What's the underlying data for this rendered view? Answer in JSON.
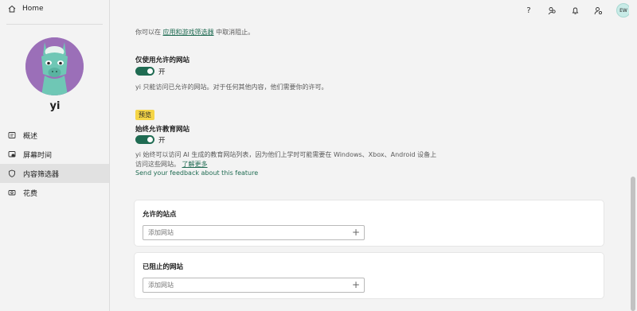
{
  "sidebar": {
    "home_label": "Home",
    "profile_name": "yi",
    "items": [
      {
        "label": "概述",
        "icon": "overview-icon"
      },
      {
        "label": "屏幕时间",
        "icon": "screen-time-icon"
      },
      {
        "label": "内容筛选器",
        "icon": "shield-icon",
        "active": true
      },
      {
        "label": "花费",
        "icon": "spending-icon"
      }
    ]
  },
  "topbar": {
    "user_initials": "EW",
    "icons": [
      "help-icon",
      "family-icon",
      "notification-icon",
      "account-settings-icon"
    ]
  },
  "main": {
    "intro_prefix": "你可以在",
    "intro_link": "应用和游戏筛选器",
    "intro_suffix": "中取消阻止。",
    "allowed_only": {
      "title": "仅使用允许的网站",
      "toggle_state": "开",
      "description": "yi 只能访问已允许的网站。对于任何其他内容，他们需要你的许可。"
    },
    "education": {
      "badge": "预览",
      "title": "始终允许教育网站",
      "toggle_state": "开",
      "description_line1": "yi 始终可以访问 AI 生成的教育网站列表，因为他们上学时可能需要在 Windows、Xbox、Android 设备上",
      "description_line2": "访问这些网站。",
      "learn_more": "了解更多",
      "feedback": "Send your feedback about this feature"
    },
    "allowed_sites": {
      "title": "允许的站点",
      "placeholder": "添加网站"
    },
    "blocked_sites": {
      "title": "已阻止的网站",
      "placeholder": "添加网站"
    }
  },
  "colors": {
    "accent": "#1f6b52",
    "badge": "#f5d547",
    "avatar_bg": "#9b6fb8",
    "user_avatar_bg": "#c8ebe7"
  }
}
